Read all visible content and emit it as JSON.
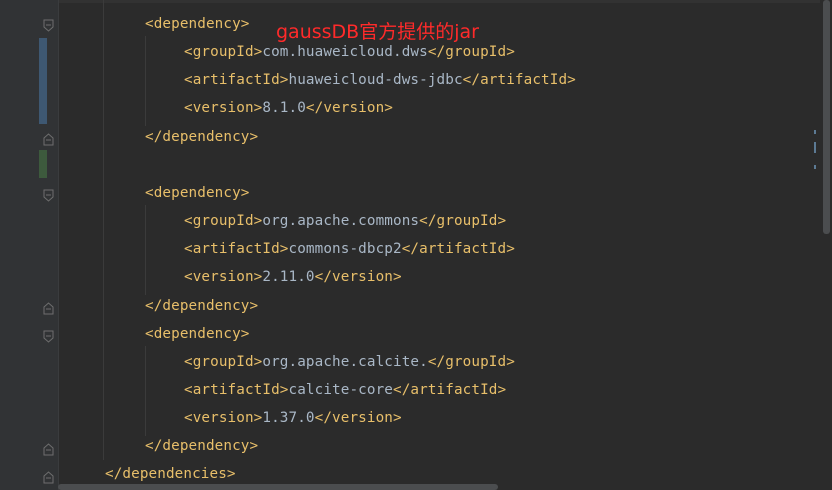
{
  "annotation": "gaussDB官方提供的jar",
  "lines": [
    {
      "open": "<dependency>",
      "text": "",
      "close": ""
    },
    {
      "open": "<groupId>",
      "text": "com.huaweicloud.dws",
      "close": "</groupId>"
    },
    {
      "open": "<artifactId>",
      "text": "huaweicloud-dws-jdbc",
      "close": "</artifactId>"
    },
    {
      "open": "<version>",
      "text": "8.1.0",
      "close": "</version>"
    },
    {
      "open": "</dependency>",
      "text": "",
      "close": ""
    },
    {
      "open": "",
      "text": "",
      "close": ""
    },
    {
      "open": "<dependency>",
      "text": "",
      "close": ""
    },
    {
      "open": "<groupId>",
      "text": "org.apache.commons",
      "close": "</groupId>"
    },
    {
      "open": "<artifactId>",
      "text": "commons-dbcp2",
      "close": "</artifactId>"
    },
    {
      "open": "<version>",
      "text": "2.11.0",
      "close": "</version>"
    },
    {
      "open": "</dependency>",
      "text": "",
      "close": ""
    },
    {
      "open": "<dependency>",
      "text": "",
      "close": ""
    },
    {
      "open": "<groupId>",
      "text": "org.apache.calcite.",
      "close": "</groupId>"
    },
    {
      "open": "<artifactId>",
      "text": "calcite-core",
      "close": "</artifactId>"
    },
    {
      "open": "<version>",
      "text": "1.37.0",
      "close": "</version>"
    },
    {
      "open": "</dependency>",
      "text": "",
      "close": ""
    },
    {
      "open": "</dependencies>",
      "text": "",
      "close": ""
    }
  ],
  "colors": {
    "background": "#2b2b2b",
    "gutter": "#313335",
    "tag": "#e8bf6a",
    "text": "#a9b7c6",
    "annotation": "#ff2a2a",
    "vcs_modified": "#3e5872",
    "vcs_added": "#3d5a3d"
  },
  "icons": {
    "fold_open": "fold-open-icon",
    "fold_close": "fold-close-icon"
  }
}
